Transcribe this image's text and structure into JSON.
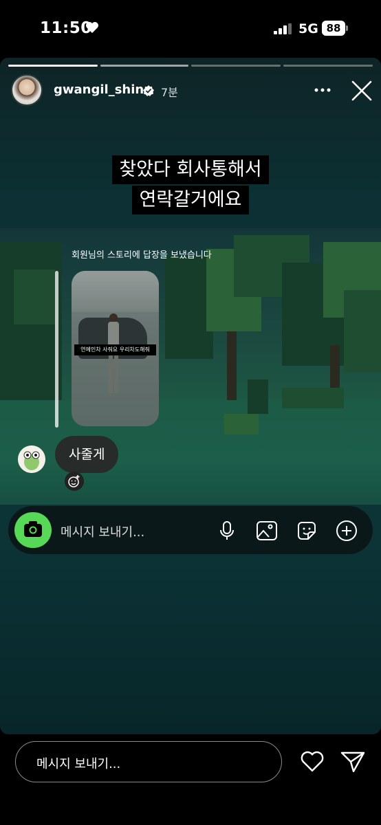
{
  "status_bar": {
    "time": "11:50",
    "network": "5G",
    "battery": "88"
  },
  "story": {
    "progress": {
      "total_segments": 4,
      "current_segment": 2
    },
    "header": {
      "username": "gwangil_shin",
      "time_ago": "7분",
      "verified": true
    },
    "caption_lines": [
      "찾았다 회사통해서",
      "연락갈거에요"
    ],
    "reply": {
      "label": "회원님의 스토리에 답장을 보냈습니다",
      "thumbnail_caption": "연예인차 사줘요 우리차도해줘",
      "message": "사줄게"
    },
    "inner_message_bar": {
      "placeholder": "메시지 보내기...",
      "icons": [
        "camera-icon",
        "microphone-icon",
        "image-icon",
        "sticker-icon",
        "add-icon"
      ]
    }
  },
  "bottom_bar": {
    "placeholder": "메시지 보내기...",
    "icons": [
      "heart-icon",
      "send-icon"
    ]
  },
  "colors": {
    "camera_button": "#57d957",
    "background": "#000000"
  }
}
